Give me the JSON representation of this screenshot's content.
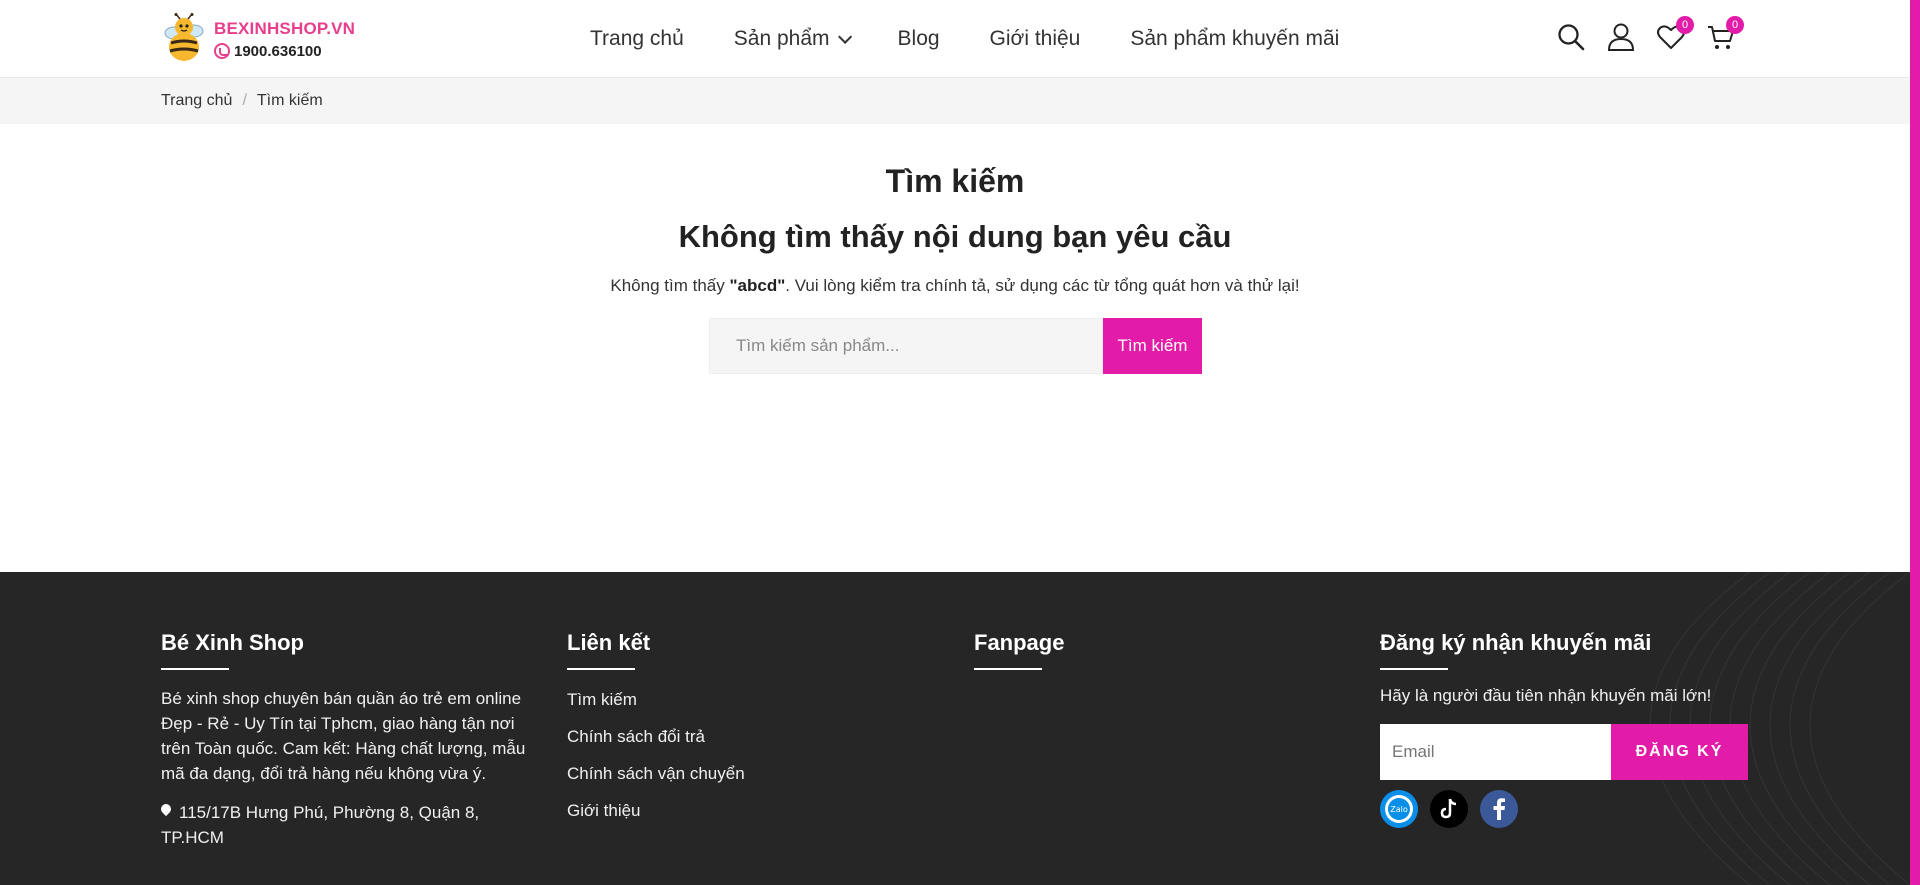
{
  "header": {
    "logo": {
      "brand": "BEXINHSHOP.VN",
      "phone": "1900.636100"
    },
    "nav": [
      {
        "label": "Trang chủ"
      },
      {
        "label": "Sản phẩm"
      },
      {
        "label": "Blog"
      },
      {
        "label": "Giới thiệu"
      },
      {
        "label": "Sản phẩm khuyến mãi"
      }
    ],
    "icons": {
      "search": "search-icon",
      "account": "user-icon",
      "wishlist": "heart-icon",
      "cart": "cart-icon"
    },
    "wishlist_count": "0",
    "cart_count": "0"
  },
  "breadcrumb": {
    "home": "Trang chủ",
    "separator": "/",
    "current": "Tìm kiếm"
  },
  "main": {
    "title": "Tìm kiếm",
    "subtitle": "Không tìm thấy nội dung bạn yêu cầu",
    "desc_prefix": "Không tìm thấy ",
    "query": "\"abcd\"",
    "desc_suffix": ". Vui lòng kiểm tra chính tả, sử dụng các từ tổng quát hơn và thử lại!",
    "search_placeholder": "Tìm kiếm sản phẩm...",
    "search_button": "Tìm kiếm"
  },
  "footer": {
    "about": {
      "title": "Bé Xinh Shop",
      "text": "Bé xinh shop chuyên bán quần áo trẻ em online Đẹp - Rẻ - Uy Tín tại Tphcm, giao hàng tận nơi trên Toàn quốc. Cam kết: Hàng chất lượng, mẫu mã đa dạng, đổi trả hàng nếu không vừa ý.",
      "address": "115/17B Hưng Phú, Phường 8, Quận 8, TP.HCM"
    },
    "links": {
      "title": "Liên kết",
      "items": [
        "Tìm kiếm",
        "Chính sách đổi trả",
        "Chính sách vận chuyển",
        "Giới thiệu"
      ]
    },
    "fanpage": {
      "title": "Fanpage"
    },
    "newsletter": {
      "title": "Đăng ký nhận khuyến mãi",
      "text": "Hãy là người đầu tiên nhận khuyến mãi lớn!",
      "email_placeholder": "Email",
      "button": "ĐĂNG KÝ",
      "zalo_label": "Zalo"
    },
    "socials": [
      "zalo-icon",
      "tiktok-icon",
      "facebook-icon"
    ]
  },
  "colors": {
    "accent": "#e21ca8",
    "brand_pink": "#e83e8c",
    "footer_bg": "#262626",
    "breadcrumb_bg": "#f5f5f5"
  }
}
